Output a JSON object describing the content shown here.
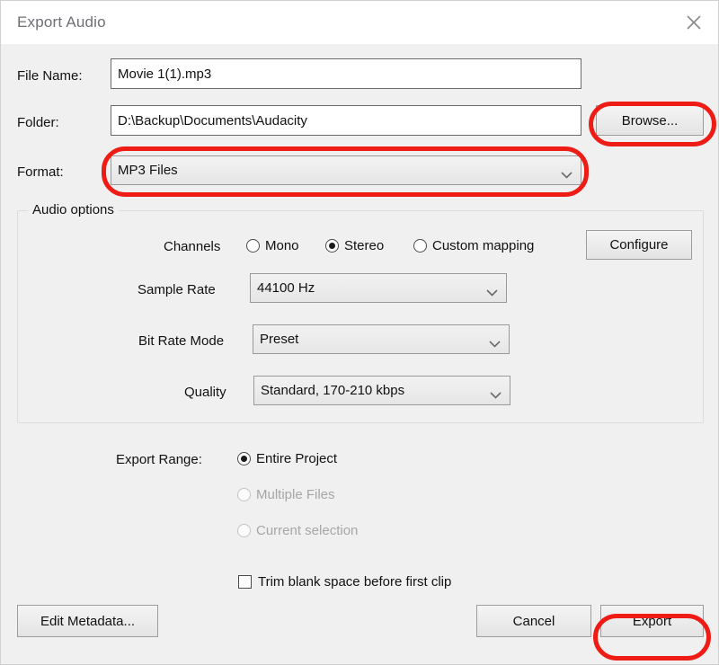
{
  "window": {
    "title": "Export Audio",
    "close_icon": "close-icon"
  },
  "form": {
    "file_name": {
      "label": "File Name:",
      "value": "Movie 1(1).mp3"
    },
    "folder": {
      "label": "Folder:",
      "value": "D:\\Backup\\Documents\\Audacity"
    },
    "browse_button": "Browse...",
    "format": {
      "label": "Format:",
      "value": "MP3 Files",
      "chevron_icon": "chevron-down-icon"
    }
  },
  "audio_options": {
    "legend": "Audio options",
    "channels": {
      "label": "Channels",
      "options": [
        {
          "label": "Mono",
          "selected": false,
          "disabled": false
        },
        {
          "label": "Stereo",
          "selected": true,
          "disabled": false
        },
        {
          "label": "Custom mapping",
          "selected": false,
          "disabled": false
        }
      ],
      "configure_button": "Configure"
    },
    "sample_rate": {
      "label": "Sample Rate",
      "value": "44100 Hz"
    },
    "bit_rate_mode": {
      "label": "Bit Rate Mode",
      "value": "Preset"
    },
    "quality": {
      "label": "Quality",
      "value": "Standard, 170-210 kbps"
    }
  },
  "export_range": {
    "label": "Export Range:",
    "options": [
      {
        "label": "Entire Project",
        "selected": true,
        "disabled": false
      },
      {
        "label": "Multiple Files",
        "selected": false,
        "disabled": true
      },
      {
        "label": "Current selection",
        "selected": false,
        "disabled": true
      }
    ]
  },
  "trim": {
    "label": "Trim blank space before first clip",
    "checked": false
  },
  "footer": {
    "edit_metadata_button": "Edit Metadata...",
    "cancel_button": "Cancel",
    "export_button": "Export"
  },
  "annotations": {
    "color": "#ee1c15",
    "highlighted": [
      "browse-button",
      "format-combobox",
      "export-button"
    ]
  }
}
